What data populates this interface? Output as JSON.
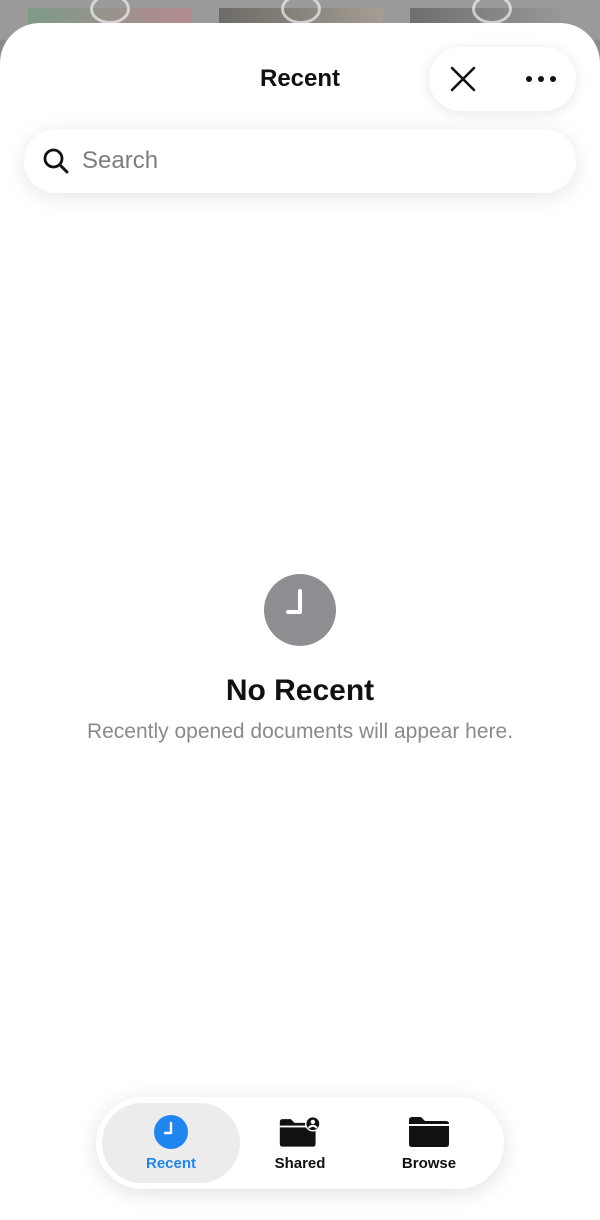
{
  "header": {
    "title": "Recent"
  },
  "actions": {
    "close_icon": "close-icon",
    "more_icon": "ellipsis-icon"
  },
  "search": {
    "placeholder": "Search",
    "value": ""
  },
  "empty_state": {
    "icon": "clock-icon",
    "title": "No Recent",
    "subtitle": "Recently opened documents will appear here."
  },
  "tabs": [
    {
      "label": "Recent",
      "icon": "clock-icon",
      "active": true
    },
    {
      "label": "Shared",
      "icon": "shared-folder-icon",
      "active": false
    },
    {
      "label": "Browse",
      "icon": "folder-icon",
      "active": false
    }
  ],
  "colors": {
    "accent": "#1f86f0",
    "empty_icon_gray": "#8e8e93",
    "subtitle_gray": "#8a8a8e"
  }
}
